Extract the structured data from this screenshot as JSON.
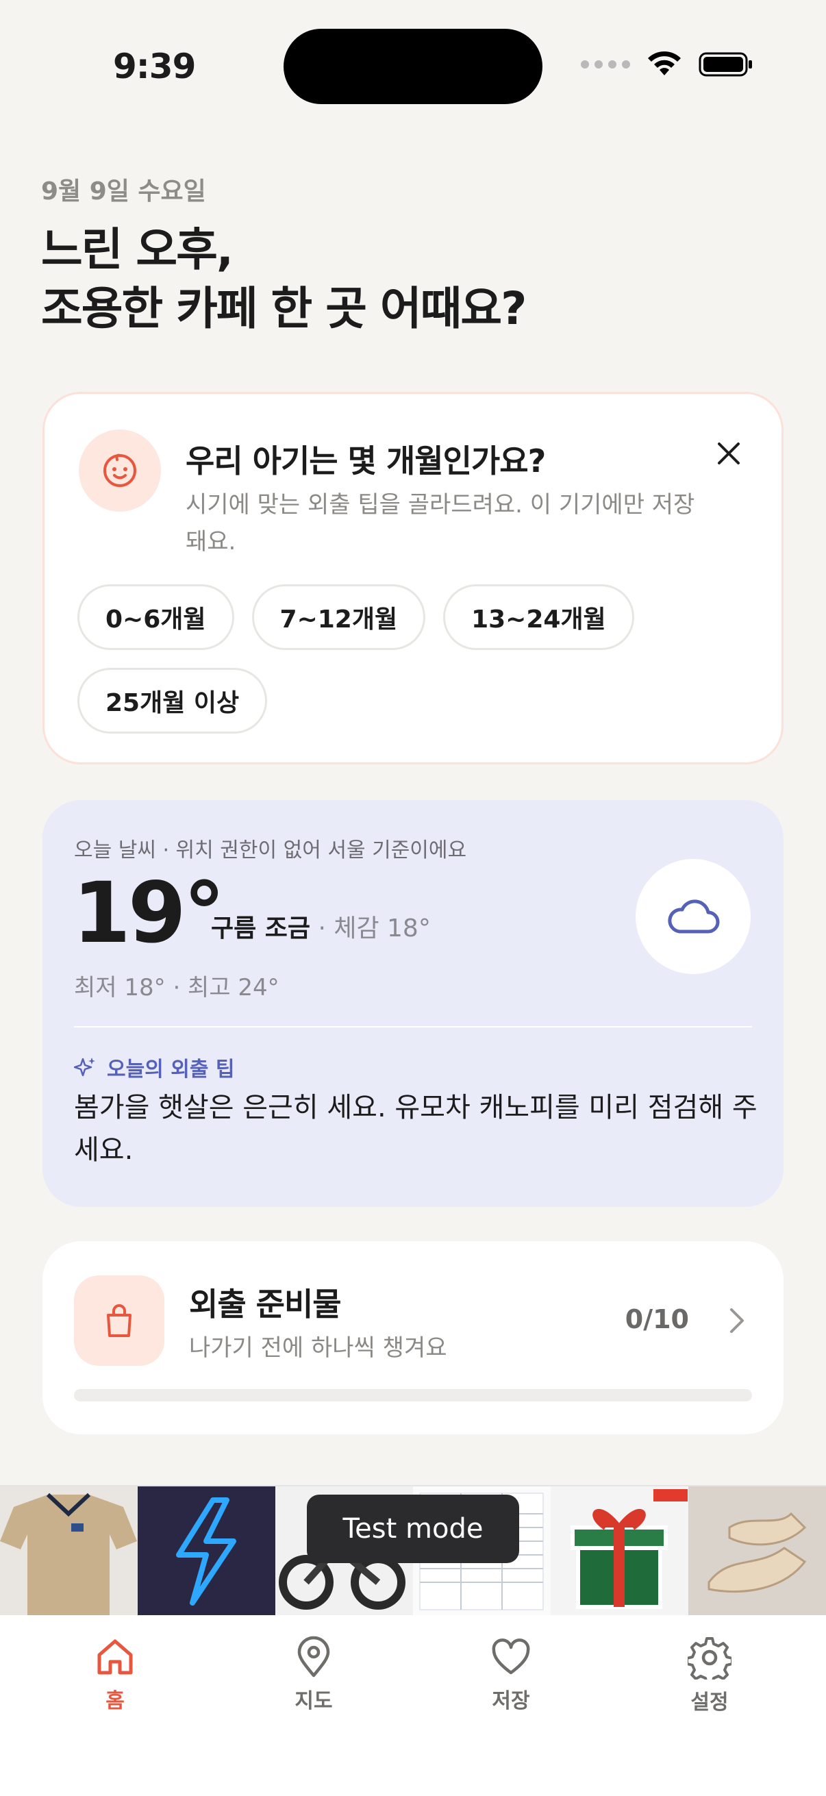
{
  "status_bar": {
    "time": "9:39"
  },
  "header": {
    "date": "9월 9일 수요일",
    "headline_line1": "느린 오후,",
    "headline_line2": "조용한 카페 한 곳 어때요?"
  },
  "age_card": {
    "title": "우리 아기는 몇 개월인가요?",
    "description": "시기에 맞는 외출 팁을 골라드려요. 이 기기에만 저장돼요.",
    "options": [
      "0~6개월",
      "7~12개월",
      "13~24개월",
      "25개월 이상"
    ],
    "icon": "baby-face-icon",
    "close_icon": "close-icon"
  },
  "weather": {
    "label": "오늘 날씨 · 위치 권한이 없어 서울 기준이에요",
    "temperature": "19°",
    "condition": "구름 조금",
    "feels_like": " · 체감 18°",
    "min_max": "최저 18° · 최고 24°",
    "icon": "cloud-icon",
    "tip_label": "오늘의 외출 팁",
    "tip_text": "봄가을 햇살은 은근히 세요. 유모차 캐노피를 미리 점검해 주세요."
  },
  "checklist": {
    "title": "외출 준비물",
    "subtitle": "나가기 전에 하나씩 챙겨요",
    "count": "0/10",
    "progress": 0,
    "icon": "shopping-bag-icon"
  },
  "ad": {
    "toast": "Test mode"
  },
  "tabs": [
    {
      "label": "홈",
      "icon": "home-icon",
      "active": true
    },
    {
      "label": "지도",
      "icon": "map-pin-icon",
      "active": false
    },
    {
      "label": "저장",
      "icon": "heart-icon",
      "active": false
    },
    {
      "label": "설정",
      "icon": "gear-icon",
      "active": false
    }
  ],
  "colors": {
    "accent": "#e8573d",
    "weather_bg": "#eaebf8",
    "tip_accent": "#5561b8",
    "page_bg": "#f5f4f1"
  }
}
